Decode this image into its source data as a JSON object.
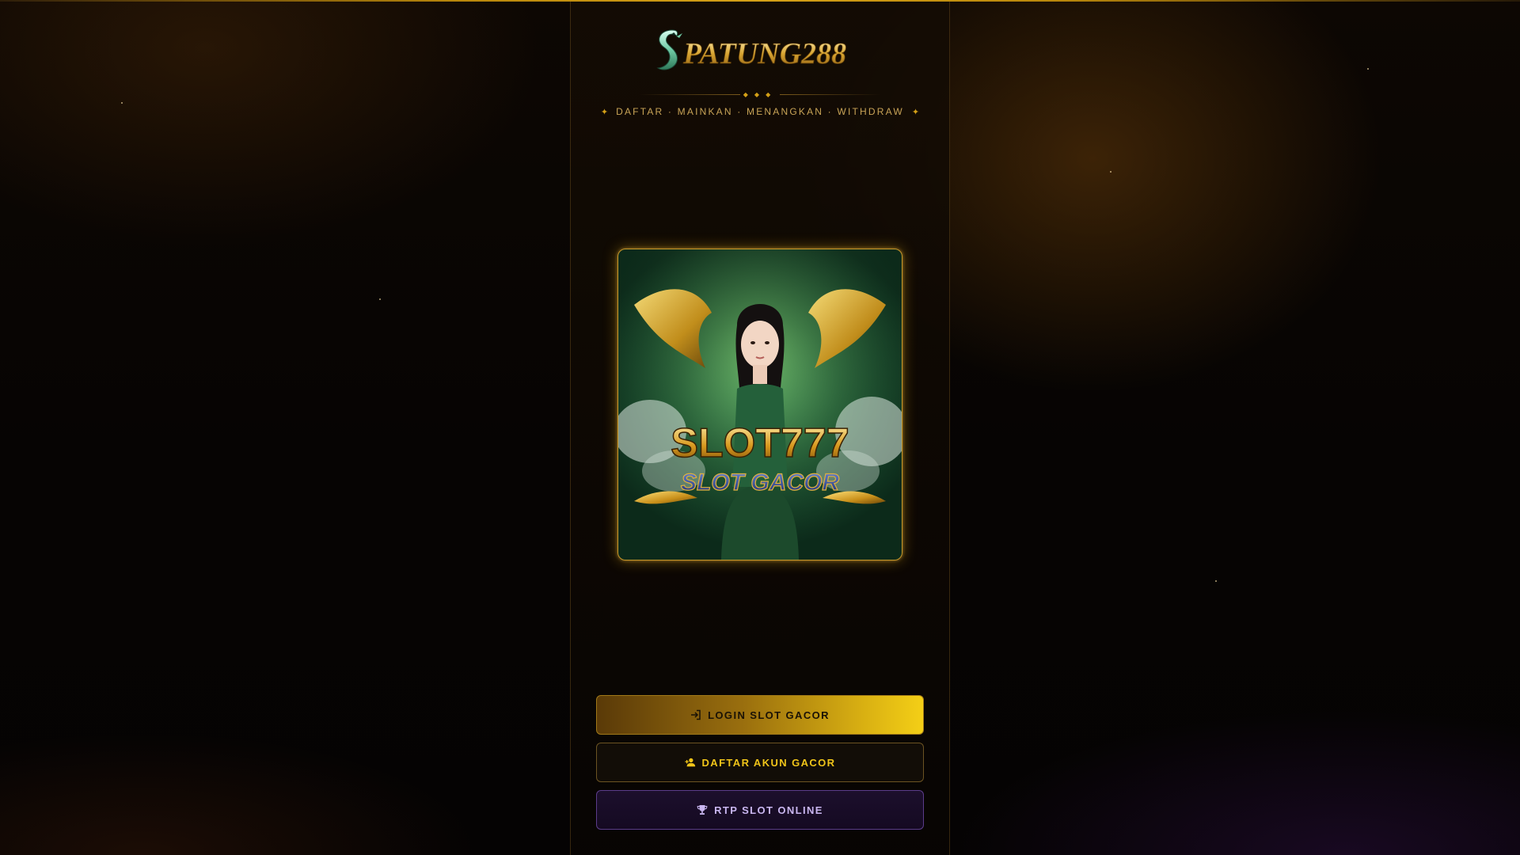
{
  "brand": {
    "logo_text": "PATUNG288",
    "logo_initial": "S"
  },
  "tagline": {
    "spark_left": "✦",
    "text": "DAFTAR · MAINKAN · MENANGKAN · WITHDRAW",
    "spark_right": "✦"
  },
  "divider": {
    "diamonds": "◆◆◆"
  },
  "banner": {
    "title": "SLOT777",
    "subtitle": "SLOT GACOR"
  },
  "buttons": {
    "login": {
      "label": "LOGIN SLOT GACOR",
      "icon": "login-icon"
    },
    "daftar": {
      "label": "DAFTAR AKUN GACOR",
      "icon": "user-plus-icon"
    },
    "rtp": {
      "label": "RTP SLOT ONLINE",
      "icon": "trophy-icon"
    }
  },
  "colors": {
    "gold": "#d4a017",
    "gold_bright": "#f4cf16",
    "dark": "#050302",
    "purple": "#5b3c8a"
  }
}
